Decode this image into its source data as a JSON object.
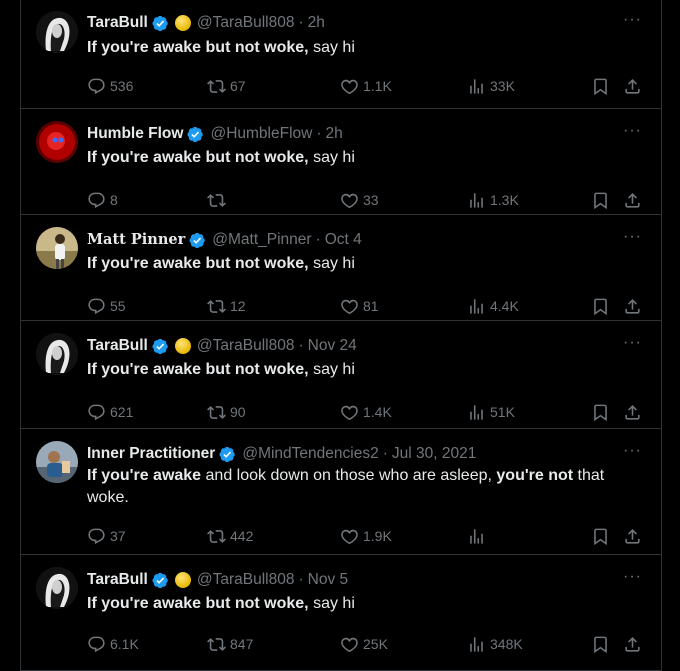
{
  "tweets": [
    {
      "name": "TaraBull",
      "handle": "@TaraBull808",
      "time": "2h",
      "gold": true,
      "text_bold1": "If you're awake but not woke,",
      "text_mid": " say hi",
      "text_bold2": "",
      "text_end": "",
      "replies": "536",
      "retweets": "67",
      "likes": "1.1K",
      "views": "33K",
      "avatar_icon": "tarabull-avatar"
    },
    {
      "name": "Humble Flow",
      "handle": "@HumbleFlow",
      "time": "2h",
      "gold": false,
      "text_bold1": "If you're awake but not woke,",
      "text_mid": " say hi",
      "text_bold2": "",
      "text_end": "",
      "replies": "8",
      "retweets": "",
      "likes": "33",
      "views": "1.3K",
      "avatar_icon": "humbleflow-avatar"
    },
    {
      "name": "Matt Pinner",
      "handle": "@Matt_Pinner",
      "time": "Oct 4",
      "gold": false,
      "text_bold1": "If you're awake but not woke,",
      "text_mid": " say hi",
      "text_bold2": "",
      "text_end": "",
      "replies": "55",
      "retweets": "12",
      "likes": "81",
      "views": "4.4K",
      "avatar_icon": "mattpinner-avatar"
    },
    {
      "name": "TaraBull",
      "handle": "@TaraBull808",
      "time": "Nov 24",
      "gold": true,
      "text_bold1": "If you're awake but not woke,",
      "text_mid": " say hi",
      "text_bold2": "",
      "text_end": "",
      "replies": "621",
      "retweets": "90",
      "likes": "1.4K",
      "views": "51K",
      "avatar_icon": "tarabull-avatar"
    },
    {
      "name": "Inner Practitioner",
      "handle": "@MindTendencies2",
      "time": "Jul 30, 2021",
      "gold": false,
      "text_bold1": "If you're awake",
      "text_mid": " and look down on those who are asleep, ",
      "text_bold2": "you're not",
      "text_end": " that woke.",
      "replies": "37",
      "retweets": "442",
      "likes": "1.9K",
      "views": "",
      "avatar_icon": "innerpractitioner-avatar"
    },
    {
      "name": "TaraBull",
      "handle": "@TaraBull808",
      "time": "Nov 5",
      "gold": true,
      "text_bold1": "If you're awake but not woke,",
      "text_mid": " say hi",
      "text_bold2": "",
      "text_end": "",
      "replies": "6.1K",
      "retweets": "847",
      "likes": "25K",
      "views": "348K",
      "avatar_icon": "tarabull-avatar"
    }
  ],
  "colors": {
    "background": "#000000",
    "text": "#e7e9ea",
    "muted": "#71767b",
    "border": "#2f3336",
    "verified": "#1d9bf0",
    "gold": "#e6b800"
  },
  "icons": [
    "verified-badge-icon",
    "gold-circle-icon",
    "more-icon",
    "reply-icon",
    "retweet-icon",
    "like-icon",
    "views-icon",
    "bookmark-icon",
    "share-icon"
  ]
}
